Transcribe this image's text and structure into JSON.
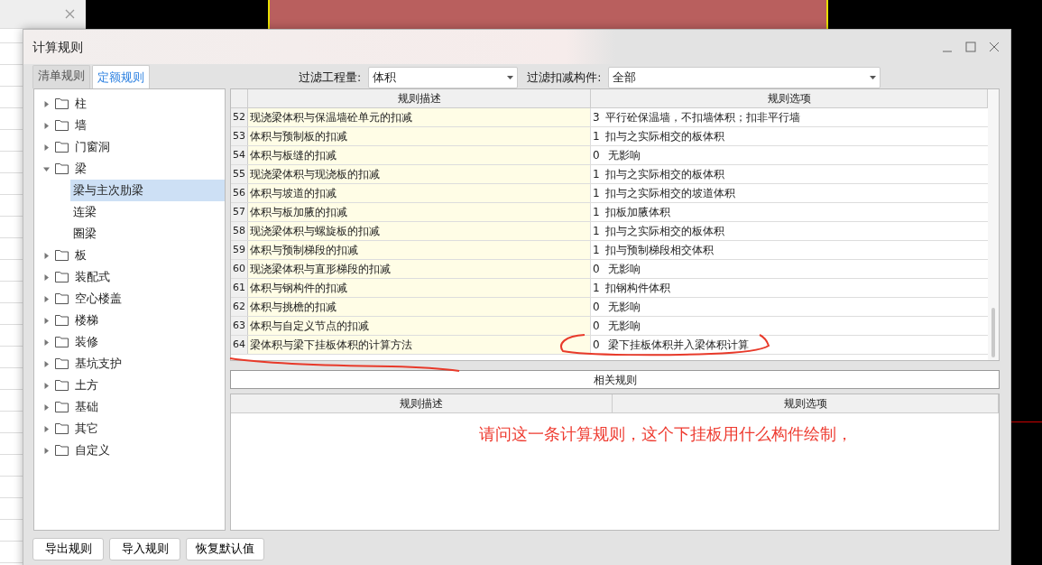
{
  "window": {
    "title": "计算规则"
  },
  "tabs": [
    {
      "label": "清单规则",
      "selected": false
    },
    {
      "label": "定额规则",
      "selected": true
    }
  ],
  "filters": [
    {
      "label": "过滤工程量:",
      "value": "体积"
    },
    {
      "label": "过滤扣减构件:",
      "value": "全部"
    }
  ],
  "tree": [
    {
      "label": "柱",
      "expanded": false,
      "selected": false
    },
    {
      "label": "墙",
      "expanded": false,
      "selected": false
    },
    {
      "label": "门窗洞",
      "expanded": false,
      "selected": false
    },
    {
      "label": "梁",
      "expanded": true,
      "selected": false,
      "children": [
        {
          "label": "梁与主次肋梁",
          "selected": true
        },
        {
          "label": "连梁",
          "selected": false
        },
        {
          "label": "圈梁",
          "selected": false
        }
      ]
    },
    {
      "label": "板",
      "expanded": false,
      "selected": false
    },
    {
      "label": "装配式",
      "expanded": false,
      "selected": false
    },
    {
      "label": "空心楼盖",
      "expanded": false,
      "selected": false
    },
    {
      "label": "楼梯",
      "expanded": false,
      "selected": false
    },
    {
      "label": "装修",
      "expanded": false,
      "selected": false
    },
    {
      "label": "基坑支护",
      "expanded": false,
      "selected": false
    },
    {
      "label": "土方",
      "expanded": false,
      "selected": false
    },
    {
      "label": "基础",
      "expanded": false,
      "selected": false
    },
    {
      "label": "其它",
      "expanded": false,
      "selected": false
    },
    {
      "label": "自定义",
      "expanded": false,
      "selected": false
    }
  ],
  "rules_table": {
    "columns": [
      "规则描述",
      "规则选项"
    ],
    "rows": [
      {
        "number": "52",
        "description": "现浇梁体积与保温墙砼单元的扣减",
        "code": "3",
        "option": "平行砼保温墙，不扣墙体积；扣非平行墙"
      },
      {
        "number": "53",
        "description": "体积与预制板的扣减",
        "code": "1",
        "option": "扣与之实际相交的板体积"
      },
      {
        "number": "54",
        "description": "体积与板缝的扣减",
        "code": "0",
        "option": " 无影响"
      },
      {
        "number": "55",
        "description": "现浇梁体积与现浇板的扣减",
        "code": "1",
        "option": "扣与之实际相交的板体积"
      },
      {
        "number": "56",
        "description": "体积与坡道的扣减",
        "code": "1",
        "option": "扣与之实际相交的坡道体积"
      },
      {
        "number": "57",
        "description": "体积与板加腋的扣减",
        "code": "1",
        "option": "扣板加腋体积"
      },
      {
        "number": "58",
        "description": "现浇梁体积与螺旋板的扣减",
        "code": "1",
        "option": "扣与之实际相交的板体积"
      },
      {
        "number": "59",
        "description": "体积与预制梯段的扣减",
        "code": "1",
        "option": "扣与预制梯段相交体积"
      },
      {
        "number": "60",
        "description": "现浇梁体积与直形梯段的扣减",
        "code": "0",
        "option": " 无影响"
      },
      {
        "number": "61",
        "description": "体积与钢构件的扣减",
        "code": "1",
        "option": "扣钢构件体积"
      },
      {
        "number": "62",
        "description": "体积与挑檐的扣减",
        "code": "0",
        "option": " 无影响"
      },
      {
        "number": "63",
        "description": "体积与自定义节点的扣减",
        "code": "0",
        "option": " 无影响"
      },
      {
        "number": "64",
        "description": "梁体积与梁下挂板体积的计算方法",
        "code": "0",
        "option": " 梁下挂板体积并入梁体积计算"
      }
    ]
  },
  "related_rules": {
    "title": "相关规则",
    "columns": [
      "规则描述",
      "规则选项"
    ]
  },
  "annotation": "请问这一条计算规则，这个下挂板用什么构件绘制，",
  "buttons": [
    "导出规则",
    "导入规则",
    "恢复默认值"
  ]
}
